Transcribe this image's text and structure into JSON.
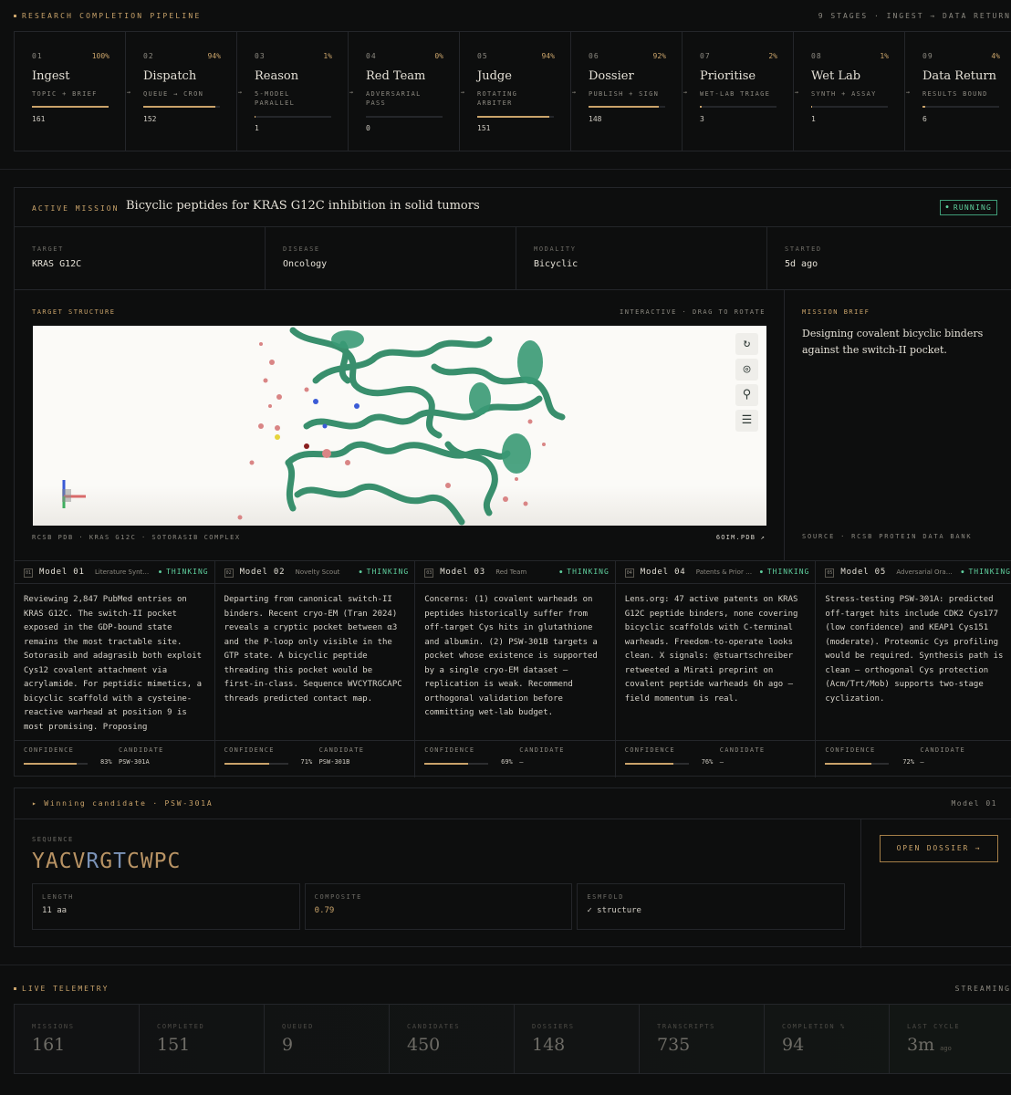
{
  "pipeline": {
    "title": "RESEARCH COMPLETION PIPELINE",
    "meta": "9 STAGES · INGEST → DATA RETURN",
    "stages": [
      {
        "num": "01",
        "pct": "100%",
        "progress": 1.0,
        "name": "Ingest",
        "sub": "TOPIC + BRIEF",
        "count": "161"
      },
      {
        "num": "02",
        "pct": "94%",
        "progress": 0.94,
        "name": "Dispatch",
        "sub": "QUEUE → CRON",
        "count": "152"
      },
      {
        "num": "03",
        "pct": "1%",
        "progress": 0.01,
        "name": "Reason",
        "sub": "5-MODEL PARALLEL",
        "count": "1"
      },
      {
        "num": "04",
        "pct": "0%",
        "progress": 0.0,
        "name": "Red Team",
        "sub": "ADVERSARIAL PASS",
        "count": "0"
      },
      {
        "num": "05",
        "pct": "94%",
        "progress": 0.94,
        "name": "Judge",
        "sub": "ROTATING ARBITER",
        "count": "151"
      },
      {
        "num": "06",
        "pct": "92%",
        "progress": 0.92,
        "name": "Dossier",
        "sub": "PUBLISH + SIGN",
        "count": "148"
      },
      {
        "num": "07",
        "pct": "2%",
        "progress": 0.02,
        "name": "Prioritise",
        "sub": "WET-LAB TRIAGE",
        "count": "3"
      },
      {
        "num": "08",
        "pct": "1%",
        "progress": 0.01,
        "name": "Wet Lab",
        "sub": "SYNTH + ASSAY",
        "count": "1"
      },
      {
        "num": "09",
        "pct": "4%",
        "progress": 0.04,
        "name": "Data Return",
        "sub": "RESULTS BOUND",
        "count": "6"
      }
    ]
  },
  "mission": {
    "label": "ACTIVE MISSION",
    "title": "Bicyclic peptides for KRAS G12C inhibition in solid tumors",
    "status": "RUNNING",
    "facts": [
      {
        "label": "TARGET",
        "value": "KRAS G12C"
      },
      {
        "label": "DISEASE",
        "value": "Oncology"
      },
      {
        "label": "MODALITY",
        "value": "Bicyclic"
      },
      {
        "label": "STARTED",
        "value": "5d ago"
      }
    ],
    "structure": {
      "label": "TARGET STRUCTURE",
      "hint": "INTERACTIVE · DRAG TO ROTATE",
      "source": "RCSB PDB · KRAS G12C · SOTORASIB COMPLEX",
      "file": "6OIM.PDB ↗"
    },
    "brief": {
      "label": "MISSION BRIEF",
      "text": "Designing covalent bicyclic binders against the switch-II pocket.",
      "source": "SOURCE · RCSB PROTEIN DATA BANK"
    }
  },
  "models": [
    {
      "idx": "01",
      "name": "Model 01",
      "role": "Literature Synthesist",
      "state": "THINKING",
      "body": "Reviewing 2,847 PubMed entries on KRAS G12C. The switch-II pocket exposed in the GDP-bound state remains the most tractable site. Sotorasib and adagrasib both exploit Cys12 covalent attachment via acrylamide. For peptidic mimetics, a bicyclic scaffold with a cysteine-reactive warhead at position 9 is most promising. Proposing YACVRGTCWPC with",
      "conf_label": "CONFIDENCE",
      "cand_label": "CANDIDATE",
      "conf": "83%",
      "conf_value": 0.83,
      "cand": "PSW-301A"
    },
    {
      "idx": "02",
      "name": "Model 02",
      "role": "Novelty Scout",
      "state": "THINKING",
      "body": "Departing from canonical switch-II binders. Recent cryo-EM (Tran 2024) reveals a cryptic pocket between α3 and the P-loop only visible in the GTP state. A bicyclic peptide threading this pocket would be first-in-class. Sequence WVCYTRGCAPC threads predicted contact map.",
      "conf_label": "CONFIDENCE",
      "cand_label": "CANDIDATE",
      "conf": "71%",
      "conf_value": 0.71,
      "cand": "PSW-301B"
    },
    {
      "idx": "03",
      "name": "Model 03",
      "role": "Red Team",
      "state": "THINKING",
      "body": "Concerns: (1) covalent warheads on peptides historically suffer from off-target Cys hits in glutathione and albumin. (2) PSW-301B targets a pocket whose existence is supported by a single cryo-EM dataset — replication is weak. Recommend orthogonal validation before committing wet-lab budget.",
      "conf_label": "CONFIDENCE",
      "cand_label": "CANDIDATE",
      "conf": "69%",
      "conf_value": 0.69,
      "cand": "—"
    },
    {
      "idx": "04",
      "name": "Model 04",
      "role": "Patents & Prior Art",
      "state": "THINKING",
      "body": "Lens.org: 47 active patents on KRAS G12C peptide binders, none covering bicyclic scaffolds with C-terminal warheads. Freedom-to-operate looks clean. X signals: @stuartschreiber retweeted a Mirati preprint on covalent peptide warheads 6h ago — field momentum is real.",
      "conf_label": "CONFIDENCE",
      "cand_label": "CANDIDATE",
      "conf": "76%",
      "conf_value": 0.76,
      "cand": "—"
    },
    {
      "idx": "05",
      "name": "Model 05",
      "role": "Adversarial Oracle",
      "state": "THINKING",
      "body": "Stress-testing PSW-301A: predicted off-target hits include CDK2 Cys177 (low confidence) and KEAP1 Cys151 (moderate). Proteomic Cys profiling would be required. Synthesis path is clean — orthogonal Cys protection (Acm/Trt/Mob) supports two-stage cyclization.",
      "conf_label": "CONFIDENCE",
      "cand_label": "CANDIDATE",
      "conf": "72%",
      "conf_value": 0.72,
      "cand": "—"
    }
  ],
  "winner": {
    "label": "Winning candidate · PSW-301A",
    "model": "Model 01",
    "seq_label": "SEQUENCE",
    "sequence": [
      {
        "aa": "YACV",
        "tone": "gold"
      },
      {
        "aa": "R",
        "tone": "blue"
      },
      {
        "aa": "G",
        "tone": "gold"
      },
      {
        "aa": "T",
        "tone": "blue"
      },
      {
        "aa": "CWPC",
        "tone": "gold"
      }
    ],
    "metrics": [
      {
        "label": "LENGTH",
        "value": "11 aa",
        "accent": false
      },
      {
        "label": "COMPOSITE",
        "value": "0.79",
        "accent": true
      },
      {
        "label": "ESMFOLD",
        "value": "✓ structure",
        "accent": false
      }
    ],
    "open_label": "OPEN DOSSIER →"
  },
  "telemetry": {
    "label": "LIVE TELEMETRY",
    "stream": "STREAMING",
    "cells": [
      {
        "label": "MISSIONS",
        "value": "161",
        "unit": ""
      },
      {
        "label": "COMPLETED",
        "value": "151",
        "unit": ""
      },
      {
        "label": "QUEUED",
        "value": "9",
        "unit": ""
      },
      {
        "label": "CANDIDATES",
        "value": "450",
        "unit": ""
      },
      {
        "label": "DOSSIERS",
        "value": "148",
        "unit": ""
      },
      {
        "label": "TRANSCRIPTS",
        "value": "735",
        "unit": ""
      },
      {
        "label": "COMPLETION %",
        "value": "94",
        "unit": ""
      },
      {
        "label": "LAST CYCLE",
        "value": "3m",
        "unit": "ago"
      }
    ]
  }
}
